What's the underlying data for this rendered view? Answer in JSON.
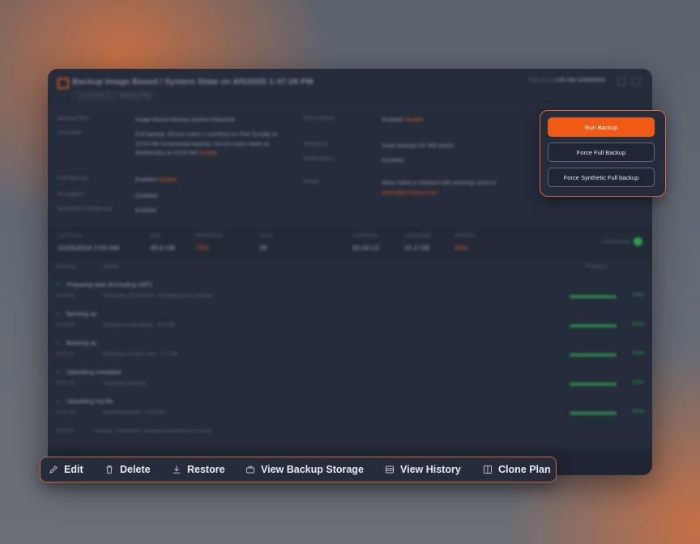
{
  "window": {
    "title": "Backup Image Based / System State on 6/5/2025 1:47:28 PM",
    "subtitle": "Local Disk (C:) · Backup Plan",
    "meta_label": "Next Run",
    "meta_value": "1:00 AM 10/29/2024"
  },
  "details": {
    "left": [
      {
        "key": "Backup Plan",
        "value": "Image-Based Backup System Required"
      },
      {
        "key": "Schedule",
        "value": "Full backup: Occurs every 1 month(s) on First Sunday at 10:00 AM",
        "value2": "Incremental backup: Occurs every week on Wednesday at 10:00 AM",
        "link": "Disable"
      },
      {
        "key": "Full Backup",
        "value": "Enabled",
        "link": "Disable"
      },
      {
        "key": "Encryption",
        "value": "Disabled"
      },
      {
        "key": "Synthetic Full Backup",
        "value": "Enabled"
      }
    ],
    "right": [
      {
        "key": "Run Checks",
        "value": "Enabled",
        "link": "Disable"
      },
      {
        "key": "Retention",
        "value": "Keep backups for 365 day(s)"
      },
      {
        "key": "Notifications",
        "value": "Disabled"
      },
      {
        "key": "Email",
        "value": "When failed or finished with warnings send to:",
        "link": "admin@company.com"
      }
    ]
  },
  "stats": [
    {
      "label": "LAST RUN",
      "value": "10/26/2024 2:00 AM",
      "accent": false
    },
    {
      "label": "SIZE",
      "value": "49.6 GB",
      "accent": false
    },
    {
      "label": "PROGRESS",
      "value": "73%",
      "accent": true
    },
    {
      "label": "FILES",
      "value": "29",
      "accent": false
    },
    {
      "label": "DURATION",
      "value": "02:40:12",
      "accent": false
    },
    {
      "label": "UPLOADED",
      "value": "15.2 GB",
      "accent": false
    },
    {
      "label": "ERRORS",
      "value": "84%",
      "accent": true
    }
  ],
  "autorun_label": "Auto Backup",
  "list_headers": {
    "duration": "Duration",
    "details": "Details",
    "progress": "Progress"
  },
  "steps": [
    {
      "name": "Preparing data (Excluding CBT)",
      "duration": "00:00:04",
      "detail": "Processed 100,000 files · Changed blocks tracking",
      "progress": 1,
      "pct": "100%"
    },
    {
      "name": "Backing up",
      "duration": "00:40:02",
      "detail": "Backing up data blocks · 49.6 GB",
      "progress": 1,
      "pct": "100%"
    },
    {
      "name": "Backing up",
      "duration": "00:20:11",
      "detail": "Backing up system state · 12.5 GB",
      "progress": 1,
      "pct": "100%"
    },
    {
      "name": "Uploading metadata",
      "duration": "00:01:22",
      "detail": "Uploading metadata",
      "progress": 1,
      "pct": "100%"
    },
    {
      "name": "Uploading log file",
      "duration": "00:00:14",
      "detail": "Uploading log file · Complete",
      "progress": 1,
      "pct": "100%"
    }
  ],
  "last_line": {
    "duration": "00:00:02",
    "detail": "Cleanup · Completed · Backup completed successfully"
  },
  "actions": {
    "run_backup": "Run Backup",
    "force_full": "Force Full Backup",
    "force_synthetic": "Force Synthetic Full backup"
  },
  "toolbar": {
    "edit": "Edit",
    "delete": "Delete",
    "restore": "Restore",
    "view_storage": "View Backup Storage",
    "view_history": "View History",
    "clone_plan": "Clone Plan"
  },
  "colors": {
    "accent": "#f05a14",
    "success": "#2fa050",
    "panel": "#252c3b"
  }
}
